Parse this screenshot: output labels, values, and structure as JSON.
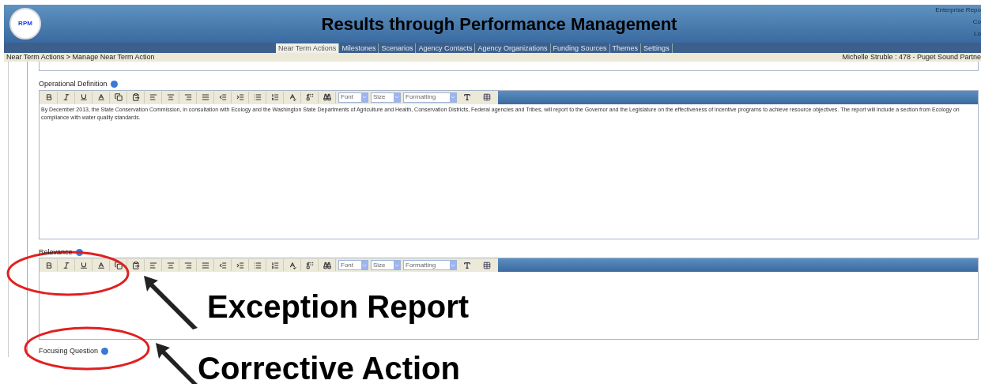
{
  "header": {
    "title": "Results through Performance Management",
    "logo_text": "RPM",
    "top_right_links": [
      "Enterprise Repo",
      "Co",
      "Lo"
    ]
  },
  "tabs": [
    {
      "label": "Near Term Actions",
      "selected": true
    },
    {
      "label": "Milestones",
      "selected": false
    },
    {
      "label": "Scenarios",
      "selected": false
    },
    {
      "label": "Agency Contacts",
      "selected": false
    },
    {
      "label": "Agency Organizations",
      "selected": false
    },
    {
      "label": "Funding Sources",
      "selected": false
    },
    {
      "label": "Themes",
      "selected": false
    },
    {
      "label": "Settings",
      "selected": false
    }
  ],
  "breadcrumb": "Near Term Actions > Manage Near Term Action",
  "user_info": "Michelle Struble : 478 - Puget Sound Partne",
  "editors": [
    {
      "label": "Operational Definition",
      "dropdowns": [
        "Font",
        "Size",
        "Formatting"
      ],
      "content": "By December 2013, the State Conservation Commission, in consultation with Ecology and the Washington State Departments of Agriculture and Health, Conservation Districts, Federal agencies and Tribes, will report to the Governor and the Legislature on the effectiveness of incentive programs to achieve resource objectives. The report will include a section from Ecology on compliance with water quality standards."
    },
    {
      "label": "Relevance",
      "dropdowns": [
        "Font",
        "Size",
        "Formatting"
      ]
    }
  ],
  "next_field": {
    "label": "Focusing Question"
  },
  "annotations": [
    {
      "text": "Exception Report"
    },
    {
      "text": "Corrective Action"
    }
  ]
}
